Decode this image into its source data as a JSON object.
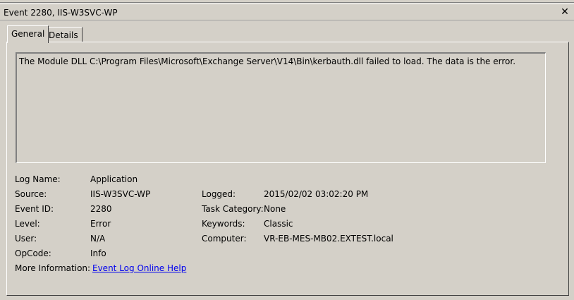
{
  "window": {
    "title": "Event 2280, IIS-W3SVC-WP",
    "close_glyph": "✕"
  },
  "tabs": [
    {
      "label": "General",
      "active": true
    },
    {
      "label": "Details",
      "active": false
    }
  ],
  "message": "The Module DLL C:\\Program Files\\Microsoft\\Exchange Server\\V14\\Bin\\kerbauth.dll failed to load.  The data is the error.",
  "fields": {
    "log_name": {
      "label": "Log Name:",
      "value": "Application"
    },
    "source": {
      "label": "Source:",
      "value": "IIS-W3SVC-WP"
    },
    "event_id": {
      "label": "Event ID:",
      "value": "2280"
    },
    "level": {
      "label": "Level:",
      "value": "Error"
    },
    "user": {
      "label": "User:",
      "value": "N/A"
    },
    "opcode": {
      "label": "OpCode:",
      "value": "Info"
    },
    "more_info": {
      "label": "More Information:",
      "value": "Event Log Online Help"
    },
    "logged": {
      "label": "Logged:",
      "value": "2015/02/02 03:02:20 PM"
    },
    "task_category": {
      "label": "Task Category:",
      "value": "None"
    },
    "keywords": {
      "label": "Keywords:",
      "value": "Classic"
    },
    "computer": {
      "label": "Computer:",
      "value": "VR-EB-MES-MB02.EXTEST.local"
    }
  }
}
